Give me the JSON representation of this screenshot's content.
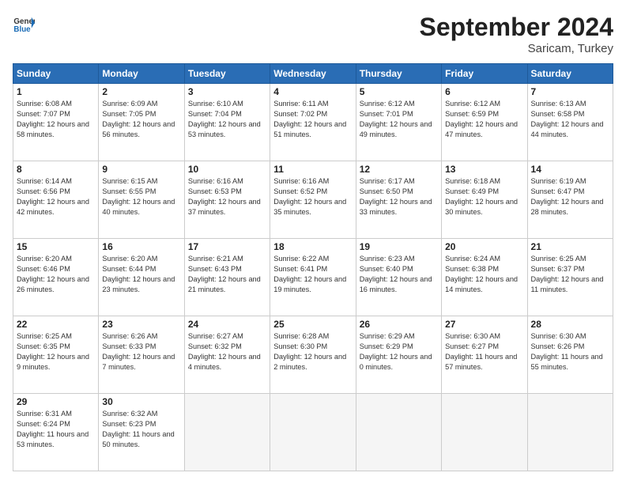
{
  "header": {
    "logo_line1": "General",
    "logo_line2": "Blue",
    "month": "September 2024",
    "location": "Saricam, Turkey"
  },
  "weekdays": [
    "Sunday",
    "Monday",
    "Tuesday",
    "Wednesday",
    "Thursday",
    "Friday",
    "Saturday"
  ],
  "days": [
    {
      "num": "",
      "info": ""
    },
    {
      "num": "",
      "info": ""
    },
    {
      "num": "",
      "info": ""
    },
    {
      "num": "1",
      "info": "Sunrise: 6:08 AM\nSunset: 7:07 PM\nDaylight: 12 hours\nand 58 minutes."
    },
    {
      "num": "2",
      "info": "Sunrise: 6:09 AM\nSunset: 7:05 PM\nDaylight: 12 hours\nand 56 minutes."
    },
    {
      "num": "3",
      "info": "Sunrise: 6:10 AM\nSunset: 7:04 PM\nDaylight: 12 hours\nand 53 minutes."
    },
    {
      "num": "4",
      "info": "Sunrise: 6:11 AM\nSunset: 7:02 PM\nDaylight: 12 hours\nand 51 minutes."
    },
    {
      "num": "5",
      "info": "Sunrise: 6:12 AM\nSunset: 7:01 PM\nDaylight: 12 hours\nand 49 minutes."
    },
    {
      "num": "6",
      "info": "Sunrise: 6:12 AM\nSunset: 6:59 PM\nDaylight: 12 hours\nand 47 minutes."
    },
    {
      "num": "7",
      "info": "Sunrise: 6:13 AM\nSunset: 6:58 PM\nDaylight: 12 hours\nand 44 minutes."
    },
    {
      "num": "8",
      "info": "Sunrise: 6:14 AM\nSunset: 6:56 PM\nDaylight: 12 hours\nand 42 minutes."
    },
    {
      "num": "9",
      "info": "Sunrise: 6:15 AM\nSunset: 6:55 PM\nDaylight: 12 hours\nand 40 minutes."
    },
    {
      "num": "10",
      "info": "Sunrise: 6:16 AM\nSunset: 6:53 PM\nDaylight: 12 hours\nand 37 minutes."
    },
    {
      "num": "11",
      "info": "Sunrise: 6:16 AM\nSunset: 6:52 PM\nDaylight: 12 hours\nand 35 minutes."
    },
    {
      "num": "12",
      "info": "Sunrise: 6:17 AM\nSunset: 6:50 PM\nDaylight: 12 hours\nand 33 minutes."
    },
    {
      "num": "13",
      "info": "Sunrise: 6:18 AM\nSunset: 6:49 PM\nDaylight: 12 hours\nand 30 minutes."
    },
    {
      "num": "14",
      "info": "Sunrise: 6:19 AM\nSunset: 6:47 PM\nDaylight: 12 hours\nand 28 minutes."
    },
    {
      "num": "15",
      "info": "Sunrise: 6:20 AM\nSunset: 6:46 PM\nDaylight: 12 hours\nand 26 minutes."
    },
    {
      "num": "16",
      "info": "Sunrise: 6:20 AM\nSunset: 6:44 PM\nDaylight: 12 hours\nand 23 minutes."
    },
    {
      "num": "17",
      "info": "Sunrise: 6:21 AM\nSunset: 6:43 PM\nDaylight: 12 hours\nand 21 minutes."
    },
    {
      "num": "18",
      "info": "Sunrise: 6:22 AM\nSunset: 6:41 PM\nDaylight: 12 hours\nand 19 minutes."
    },
    {
      "num": "19",
      "info": "Sunrise: 6:23 AM\nSunset: 6:40 PM\nDaylight: 12 hours\nand 16 minutes."
    },
    {
      "num": "20",
      "info": "Sunrise: 6:24 AM\nSunset: 6:38 PM\nDaylight: 12 hours\nand 14 minutes."
    },
    {
      "num": "21",
      "info": "Sunrise: 6:25 AM\nSunset: 6:37 PM\nDaylight: 12 hours\nand 11 minutes."
    },
    {
      "num": "22",
      "info": "Sunrise: 6:25 AM\nSunset: 6:35 PM\nDaylight: 12 hours\nand 9 minutes."
    },
    {
      "num": "23",
      "info": "Sunrise: 6:26 AM\nSunset: 6:33 PM\nDaylight: 12 hours\nand 7 minutes."
    },
    {
      "num": "24",
      "info": "Sunrise: 6:27 AM\nSunset: 6:32 PM\nDaylight: 12 hours\nand 4 minutes."
    },
    {
      "num": "25",
      "info": "Sunrise: 6:28 AM\nSunset: 6:30 PM\nDaylight: 12 hours\nand 2 minutes."
    },
    {
      "num": "26",
      "info": "Sunrise: 6:29 AM\nSunset: 6:29 PM\nDaylight: 12 hours\nand 0 minutes."
    },
    {
      "num": "27",
      "info": "Sunrise: 6:30 AM\nSunset: 6:27 PM\nDaylight: 11 hours\nand 57 minutes."
    },
    {
      "num": "28",
      "info": "Sunrise: 6:30 AM\nSunset: 6:26 PM\nDaylight: 11 hours\nand 55 minutes."
    },
    {
      "num": "29",
      "info": "Sunrise: 6:31 AM\nSunset: 6:24 PM\nDaylight: 11 hours\nand 53 minutes."
    },
    {
      "num": "30",
      "info": "Sunrise: 6:32 AM\nSunset: 6:23 PM\nDaylight: 11 hours\nand 50 minutes."
    },
    {
      "num": "",
      "info": ""
    },
    {
      "num": "",
      "info": ""
    },
    {
      "num": "",
      "info": ""
    },
    {
      "num": "",
      "info": ""
    },
    {
      "num": "",
      "info": ""
    }
  ]
}
